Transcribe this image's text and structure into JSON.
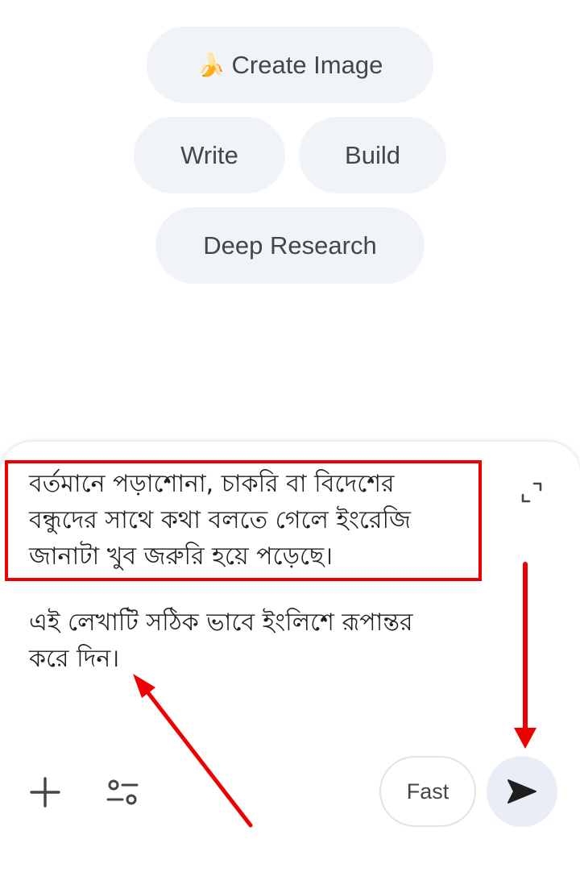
{
  "suggestions": {
    "create_image": {
      "emoji": "🍌",
      "label": "Create Image"
    },
    "write": {
      "label": "Write"
    },
    "build": {
      "label": "Build"
    },
    "deep_research": {
      "label": "Deep Research"
    }
  },
  "composer": {
    "paragraph_1": "বর্তমানে পড়াশোনা, চাকরি বা বিদেশের\nবন্ধুদের সাথে কথা বলতে গেলে ইংরেজি\nজানাটা খুব জরুরি হয়ে পড়েছে।",
    "paragraph_2": "এই লেখাটি সঠিক ভাবে ইংলিশে রূপান্তর\nকরে দিন।",
    "mode_label": "Fast",
    "icons": {
      "expand": "expand-icon",
      "add": "plus-icon",
      "tools": "tools-sliders-icon",
      "send": "send-icon"
    }
  },
  "annotation": {
    "color": "#ee0000",
    "highlight": "highlighted-prompt-box",
    "arrows": [
      "arrow-to-instruction",
      "arrow-to-send-button"
    ]
  },
  "colors": {
    "chip_background": "#f0f4f9",
    "chip_text": "#444746",
    "send_background": "#e9eef6",
    "annotation_red": "#ee0000"
  }
}
